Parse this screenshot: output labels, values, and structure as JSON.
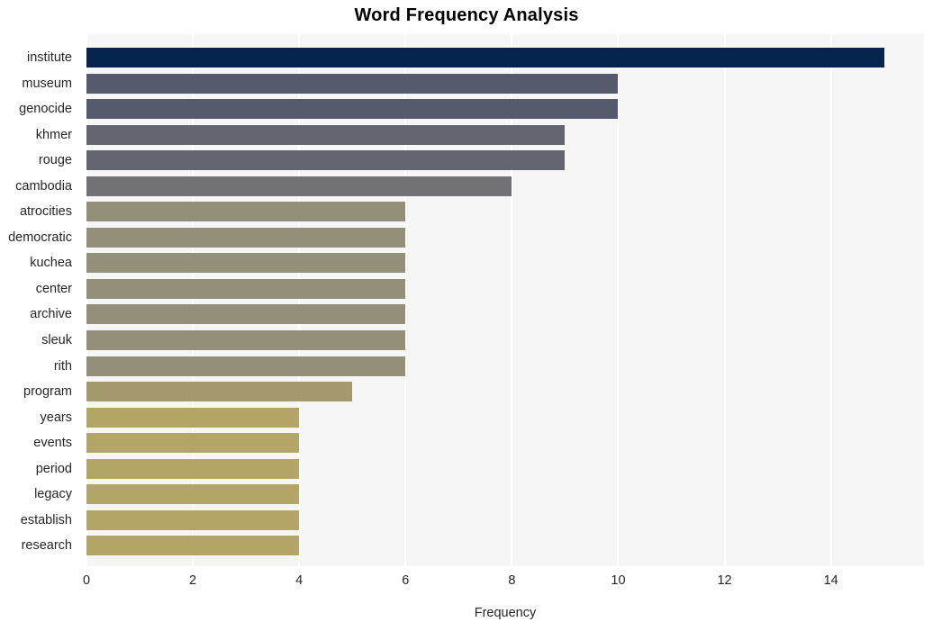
{
  "chart_data": {
    "type": "bar",
    "orientation": "horizontal",
    "title": "Word Frequency Analysis",
    "xlabel": "Frequency",
    "ylabel": "",
    "categories": [
      "institute",
      "museum",
      "genocide",
      "khmer",
      "rouge",
      "cambodia",
      "atrocities",
      "democratic",
      "kuchea",
      "center",
      "archive",
      "sleuk",
      "rith",
      "program",
      "years",
      "events",
      "period",
      "legacy",
      "establish",
      "research"
    ],
    "values": [
      15,
      10,
      10,
      9,
      9,
      8,
      6,
      6,
      6,
      6,
      6,
      6,
      6,
      5,
      4,
      4,
      4,
      4,
      4,
      4
    ],
    "bar_colors": [
      "#04244d",
      "#555a6d",
      "#555a6d",
      "#64666f",
      "#64666f",
      "#727276",
      "#938f78",
      "#938f78",
      "#938f78",
      "#938f78",
      "#938f78",
      "#938f78",
      "#938f78",
      "#a59a6e",
      "#b3a566",
      "#b3a566",
      "#b3a566",
      "#b3a566",
      "#b3a566",
      "#b3a566"
    ],
    "xlim": [
      0,
      15.75
    ],
    "xticks": [
      0,
      2,
      4,
      6,
      8,
      10,
      12,
      14
    ],
    "xticklabels": [
      "0",
      "2",
      "4",
      "6",
      "8",
      "10",
      "12",
      "14"
    ],
    "grid": true,
    "grid_color": "#ffffff",
    "plot_background": "#f6f6f7",
    "figure_background": "#ffffff",
    "legend": null,
    "text_color": "#262626"
  }
}
